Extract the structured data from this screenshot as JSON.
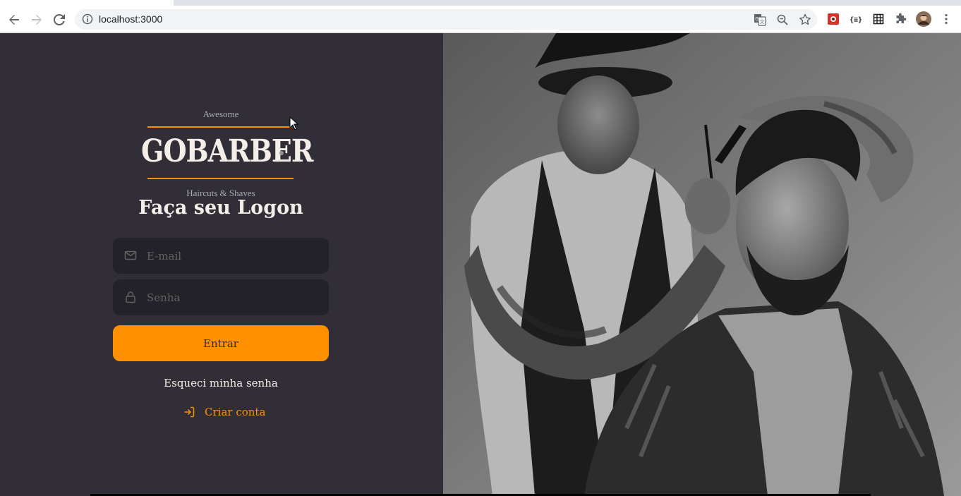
{
  "browser": {
    "url": "localhost:3000"
  },
  "logo": {
    "top_text": "Awesome",
    "brand": "GOBARBER",
    "tagline": "Haircuts & Shaves"
  },
  "form": {
    "title": "Faça seu Logon",
    "email_placeholder": "E-mail",
    "password_placeholder": "Senha",
    "submit_label": "Entrar",
    "forgot_label": "Esqueci minha senha"
  },
  "create_account": {
    "label": "Criar conta"
  },
  "colors": {
    "background": "#312e38",
    "input_background": "#232129",
    "accent": "#ff9000",
    "text": "#f4ede8",
    "placeholder": "#666360"
  }
}
